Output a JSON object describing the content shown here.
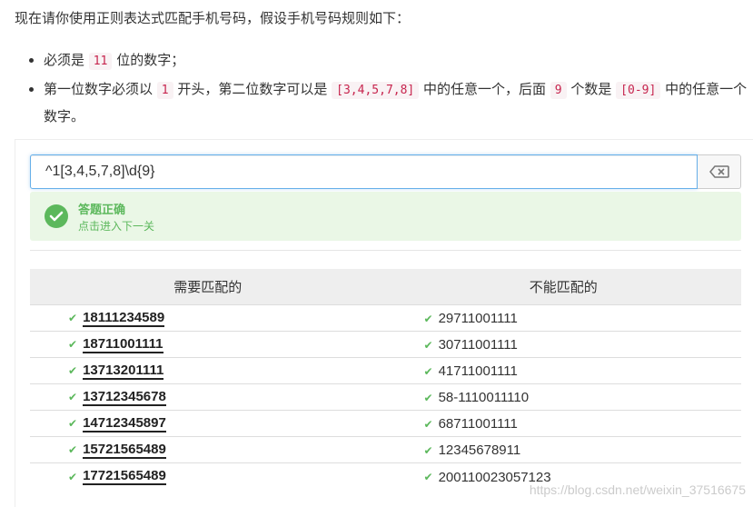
{
  "intro": "现在请你使用正则表达式匹配手机号码，假设手机号码规则如下：",
  "rules": {
    "r1_before": "必须是 ",
    "r1_code": "11",
    "r1_after": " 位的数字；",
    "r2_a": "第一位数字必须以 ",
    "r2_code1": "1",
    "r2_b": " 开头，第二位数字可以是 ",
    "r2_code2": "[3,4,5,7,8]",
    "r2_c": " 中的任意一个，后面 ",
    "r2_code3": "9",
    "r2_d": " 个数是 ",
    "r2_code4": "[0-9]",
    "r2_e": " 中的任意一个数字。"
  },
  "regex_input": {
    "value": "^1[3,4,5,7,8]\\d{9}"
  },
  "result": {
    "title": "答题正确",
    "link": "点击进入下一关"
  },
  "table": {
    "headers": {
      "match": "需要匹配的",
      "nomatch": "不能匹配的"
    },
    "rows": [
      {
        "match": "18111234589",
        "nomatch": "29711001111"
      },
      {
        "match": "18711001111",
        "nomatch": "30711001111"
      },
      {
        "match": "13713201111",
        "nomatch": "41711001111"
      },
      {
        "match": "13712345678",
        "nomatch": "58-1110011110"
      },
      {
        "match": "14712345897",
        "nomatch": "68711001111"
      },
      {
        "match": "15721565489",
        "nomatch": "12345678911"
      },
      {
        "match": "17721565489",
        "nomatch": "200110023057123"
      }
    ]
  },
  "watermark": "https://blog.csdn.net/weixin_37516675",
  "colors": {
    "success": "#5cb85c",
    "success_bg": "#eaf7e6",
    "code": "#c7254e",
    "input_border": "#66afe9"
  }
}
